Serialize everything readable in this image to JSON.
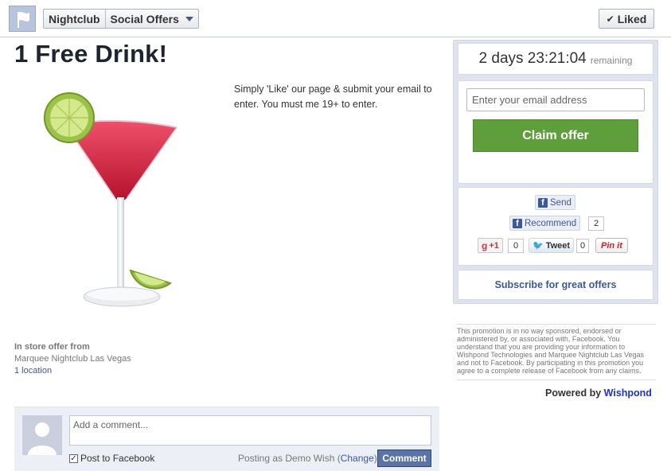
{
  "topbar": {
    "crumb_page": "Nightclub",
    "crumb_app": "Social Offers",
    "liked_label": "Liked",
    "liked_check": "✔"
  },
  "offer": {
    "title": "1 Free Drink!",
    "description": "Simply 'Like' our page & submit your email to enter. You must me 19+ to enter.",
    "instore_label": "In store offer from",
    "instore_business": "Marquee Nightclub Las Vegas",
    "instore_locations": "1 location"
  },
  "timer": {
    "countdown": "2 days 23:21:04",
    "suffix": "remaining"
  },
  "claim": {
    "email_placeholder": "Enter your email address",
    "button_label": "Claim offer"
  },
  "social": {
    "send_label": "Send",
    "recommend_label": "Recommend",
    "recommend_count": "2",
    "gplus_label": "+1",
    "gplus_count": "0",
    "tweet_label": "Tweet",
    "tweet_count": "0",
    "pinit_label": "Pin it",
    "fb_glyph": "f"
  },
  "subscribe_label": "Subscribe for great offers",
  "disclaimer": "This promotion is in no way sponsored, endorsed or administered by, or associated with, Facebook. You understand that you are providing your information to Wishpond Technologies and Marquee Nightclub Las Vegas and not to Facebook. By participating in this promotion you agree to a complete release of Facebook from any claims.",
  "powered": {
    "prefix": "Powered by",
    "brand": "Wishpond"
  },
  "comments": {
    "placeholder": "Add a comment...",
    "post_to_fb": "Post to Facebook",
    "posting_as_prefix": "Posting as Demo Wish (",
    "change_link": "Change",
    "posting_as_suffix": ")",
    "button_label": "Comment"
  },
  "colors": {
    "fb_blue": "#3b5998",
    "claim_green": "#5e9e3b",
    "wishpond_blue": "#1a33cc"
  }
}
